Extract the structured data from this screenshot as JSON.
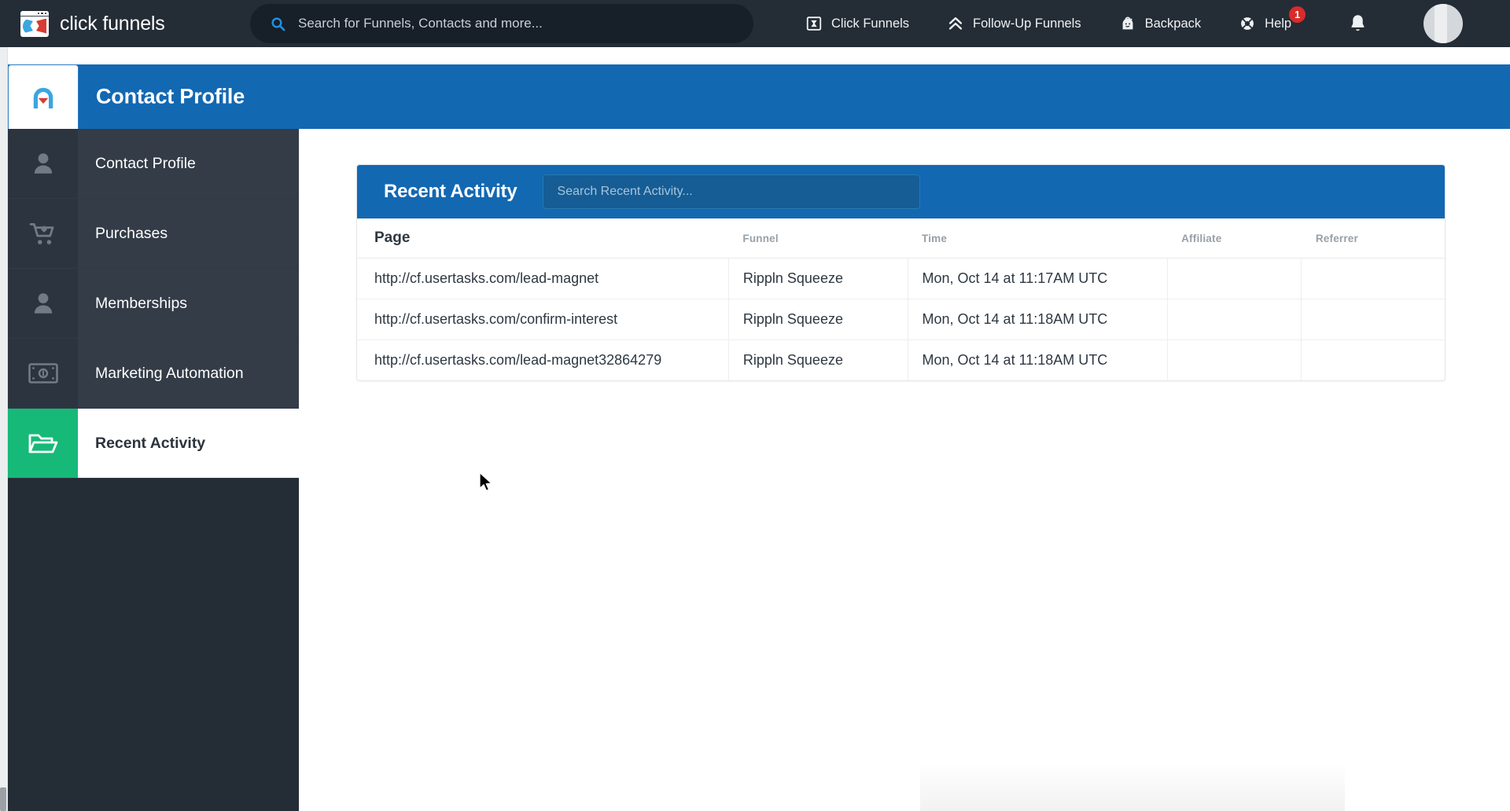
{
  "app": {
    "brand_name": "click funnels",
    "brand_logo_icon": "clickfunnels-logo-icon"
  },
  "global_search": {
    "placeholder": "Search for Funnels, Contacts and more...",
    "value": "",
    "icon": "search-icon"
  },
  "topnav": {
    "items": [
      {
        "label": "Click Funnels",
        "icon": "funnel-box-icon"
      },
      {
        "label": "Follow-Up Funnels",
        "icon": "double-chevron-up-icon"
      },
      {
        "label": "Backpack",
        "icon": "backpack-icon"
      },
      {
        "label": "Help",
        "icon": "lifebuoy-icon",
        "badge": "1"
      }
    ],
    "bell_icon": "bell-icon",
    "avatar_icon": "user-avatar"
  },
  "page": {
    "title": "Contact Profile",
    "header_color": "#1368b2",
    "logo_icon": "contact-profile-logo-icon"
  },
  "sidebar": {
    "items": [
      {
        "label": "Contact Profile",
        "icon": "person-icon",
        "active": false
      },
      {
        "label": "Purchases",
        "icon": "shopping-cart-icon",
        "active": false
      },
      {
        "label": "Memberships",
        "icon": "person-icon",
        "active": false
      },
      {
        "label": "Marketing Automation",
        "icon": "money-bill-icon",
        "active": false
      },
      {
        "label": "Recent Activity",
        "icon": "open-folder-icon",
        "active": true
      }
    ],
    "active_accent": "#17b978"
  },
  "recent_activity": {
    "title": "Recent Activity",
    "search": {
      "placeholder": "Search Recent Activity...",
      "value": ""
    },
    "columns": [
      "Page",
      "Funnel",
      "Time",
      "Affiliate",
      "Referrer"
    ],
    "rows": [
      {
        "page": "http://cf.usertasks.com/lead-magnet",
        "funnel": "Rippln Squeeze",
        "time": "Mon, Oct 14 at 11:17AM UTC",
        "affiliate": "",
        "referrer": ""
      },
      {
        "page": "http://cf.usertasks.com/confirm-interest",
        "funnel": "Rippln Squeeze",
        "time": "Mon, Oct 14 at 11:18AM UTC",
        "affiliate": "",
        "referrer": ""
      },
      {
        "page": "http://cf.usertasks.com/lead-magnet32864279",
        "funnel": "Rippln Squeeze",
        "time": "Mon, Oct 14 at 11:18AM UTC",
        "affiliate": "",
        "referrer": ""
      }
    ]
  }
}
